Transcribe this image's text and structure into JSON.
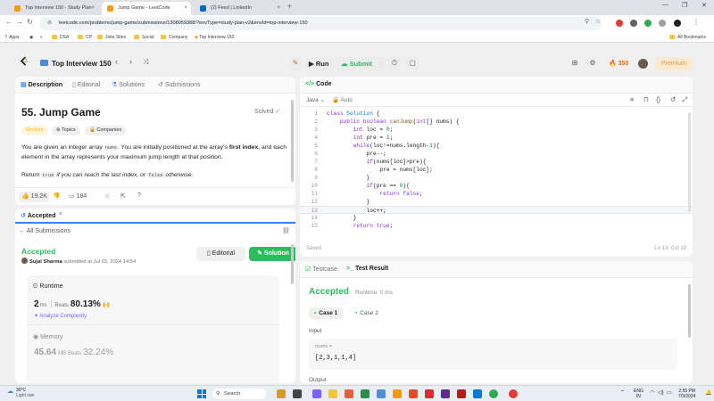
{
  "browser": {
    "tabs": [
      {
        "label": "Top Interview 150 - Study Plan",
        "color": "#f59e0b"
      },
      {
        "label": "Jump Game - LeetCode",
        "color": "#f59e0b"
      },
      {
        "label": "(2) Feed | LinkedIn",
        "color": "#0a66c2"
      }
    ],
    "url": "leetcode.com/problems/jump-game/submissions/1308059388/?envType=study-plan-v2&envId=top-interview-150",
    "bookmarks": [
      "Apps",
      "DSA",
      "CP",
      "Jobs Sites",
      "Social",
      "Company",
      "Top Interview 150"
    ],
    "all_bookmarks": "All Bookmarks"
  },
  "nav": {
    "list_title": "Top Interview 150",
    "run_label": "Run",
    "submit_label": "Submit",
    "streak": "350",
    "premium_label": "Premium"
  },
  "desc_panel": {
    "tabs": [
      "Description",
      "Editorial",
      "Solutions",
      "Submissions"
    ],
    "title": "55. Jump Game",
    "status": "Solved",
    "difficulty": "Medium",
    "tags": [
      "Topics",
      "Companies"
    ],
    "para1_a": "You are given an integer array ",
    "para1_code": "nums",
    "para1_b": ". You are initially positioned at the array's ",
    "para1_bold": "first index",
    "para1_c": ", and each element in the array represents your maximum jump length at that position.",
    "para2_a": "Return ",
    "para2_code1": "true",
    "para2_b": " if you can reach the last index, or ",
    "para2_code2": "false",
    "para2_c": " otherwise.",
    "likes": "19.2K",
    "comments": "184"
  },
  "sub_panel": {
    "tab_label": "Accepted",
    "back_label": "All Submissions",
    "status": "Accepted",
    "author": "Sujal Sharma",
    "submitted_text": "submitted at Jul 03, 2024 14:54",
    "editorial_btn": "Editorial",
    "solution_btn": "Solution",
    "runtime_label": "Runtime",
    "runtime_value": "2",
    "runtime_unit": "ms",
    "beats_label": "Beats",
    "runtime_pct": "80.13%",
    "analyze_label": "Analyze Complexity",
    "memory_label": "Memory",
    "memory_value": "45.64",
    "memory_unit": "MB",
    "memory_pct": "32.24%"
  },
  "code_panel": {
    "title": "Code",
    "language": "Java",
    "mode": "Auto",
    "lines": [
      {
        "n": "1",
        "parts": [
          [
            "kw",
            "class "
          ],
          [
            "ty",
            "Solution"
          ],
          [
            "id",
            " {"
          ]
        ]
      },
      {
        "n": "2",
        "parts": [
          [
            "id",
            "    "
          ],
          [
            "kw",
            "public "
          ],
          [
            "kw",
            "boolean "
          ],
          [
            "fn",
            "canJump"
          ],
          [
            "id",
            "("
          ],
          [
            "kw",
            "int"
          ],
          [
            "id",
            "[] nums) {"
          ]
        ]
      },
      {
        "n": "3",
        "parts": [
          [
            "id",
            "        "
          ],
          [
            "kw",
            "int "
          ],
          [
            "id",
            "loc = "
          ],
          [
            "num",
            "0"
          ],
          [
            "id",
            ";"
          ]
        ]
      },
      {
        "n": "4",
        "parts": [
          [
            "id",
            "        "
          ],
          [
            "kw",
            "int "
          ],
          [
            "id",
            "pre = "
          ],
          [
            "num",
            "1"
          ],
          [
            "id",
            ";"
          ]
        ]
      },
      {
        "n": "5",
        "parts": [
          [
            "id",
            "        "
          ],
          [
            "kw",
            "while"
          ],
          [
            "id",
            "(loc!=nums.length-"
          ],
          [
            "num",
            "1"
          ],
          [
            "id",
            "){"
          ]
        ]
      },
      {
        "n": "6",
        "parts": [
          [
            "id",
            "            pre--;"
          ]
        ]
      },
      {
        "n": "7",
        "parts": [
          [
            "id",
            "            "
          ],
          [
            "kw",
            "if"
          ],
          [
            "id",
            "(nums[loc]>pre){"
          ]
        ]
      },
      {
        "n": "8",
        "parts": [
          [
            "id",
            "                pre = nums[loc];"
          ]
        ]
      },
      {
        "n": "9",
        "parts": [
          [
            "id",
            "            }"
          ]
        ]
      },
      {
        "n": "10",
        "parts": [
          [
            "id",
            "            "
          ],
          [
            "kw",
            "if"
          ],
          [
            "id",
            "(pre == "
          ],
          [
            "num",
            "0"
          ],
          [
            "id",
            "){"
          ]
        ]
      },
      {
        "n": "11",
        "parts": [
          [
            "id",
            "                "
          ],
          [
            "kw",
            "return "
          ],
          [
            "kw",
            "false"
          ],
          [
            "id",
            ";"
          ]
        ]
      },
      {
        "n": "12",
        "parts": [
          [
            "id",
            "            }"
          ]
        ]
      },
      {
        "n": "13",
        "parts": [
          [
            "id",
            "            loc++;"
          ]
        ]
      },
      {
        "n": "14",
        "parts": [
          [
            "id",
            "        }"
          ]
        ]
      },
      {
        "n": "15",
        "parts": [
          [
            "id",
            "        "
          ],
          [
            "kw",
            "return "
          ],
          [
            "kw",
            "true"
          ],
          [
            "id",
            ";"
          ]
        ]
      }
    ],
    "saved_label": "Saved",
    "cursor_pos": "Ln 13, Col 19"
  },
  "test_panel": {
    "tabs": [
      "Testcase",
      "Test Result"
    ],
    "status": "Accepted",
    "runtime_text": "Runtime: 0 ms",
    "cases": [
      "Case 1",
      "Case 2"
    ],
    "input_label": "Input",
    "param_name": "nums =",
    "param_value": "[2,3,1,1,4]",
    "output_label": "Output"
  },
  "taskbar": {
    "temp": "30°C",
    "weather": "Light rain",
    "search_placeholder": "Search",
    "lang": "ENG",
    "region": "IN",
    "time": "2:55 PM",
    "date": "7/3/2024"
  }
}
